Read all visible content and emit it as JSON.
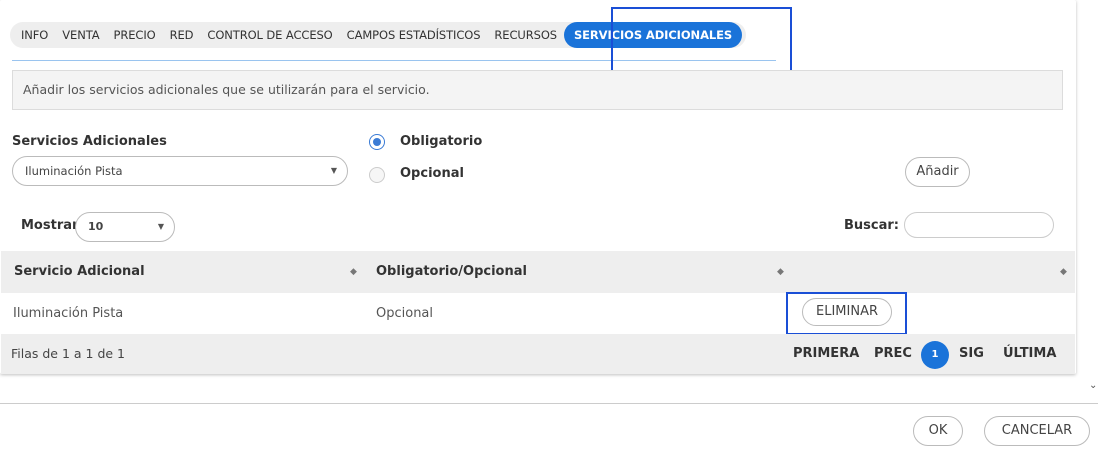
{
  "tabs": [
    {
      "label": "INFO"
    },
    {
      "label": "VENTA"
    },
    {
      "label": "PRECIO"
    },
    {
      "label": "RED"
    },
    {
      "label": "CONTROL DE ACCESO"
    },
    {
      "label": "CAMPOS ESTADÍSTICOS"
    },
    {
      "label": "RECURSOS"
    },
    {
      "label": "SERVICIOS ADICIONALES"
    }
  ],
  "info_text": "Añadir los servicios adicionales que se utilizarán para el servicio.",
  "form": {
    "services_label": "Servicios Adicionales",
    "services_selected": "Iluminación Pista",
    "radio_mandatory": "Obligatorio",
    "radio_optional": "Opcional",
    "add_button": "Añadir"
  },
  "list_controls": {
    "show_label": "Mostrar",
    "show_value": "10",
    "search_label": "Buscar:"
  },
  "table": {
    "columns": [
      "Servicio Adicional",
      "Obligatorio/Opcional",
      ""
    ],
    "rows": [
      {
        "service": "Iluminación Pista",
        "type": "Opcional",
        "action": "ELIMINAR"
      }
    ],
    "footer_info": "Filas de 1 a 1 de 1",
    "pager": {
      "first": "PRIMERA",
      "prev": "PREC",
      "current": "1",
      "next": "SIG",
      "last": "ÚLTIMA"
    }
  },
  "dialog_buttons": {
    "ok": "OK",
    "cancel": "CANCELAR"
  },
  "icons": {
    "sort": "sort-icon",
    "dropdown": "chevron-down-icon"
  },
  "colors": {
    "accent": "#1a73d9",
    "highlight": "#1a4fd6"
  }
}
